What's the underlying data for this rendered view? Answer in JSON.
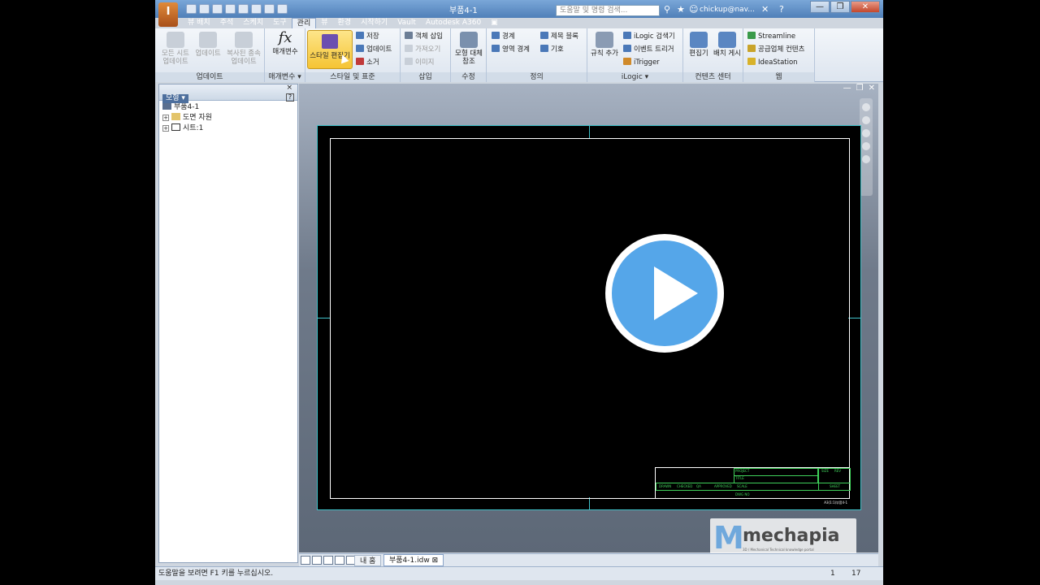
{
  "app": {
    "logo_letter": "I",
    "title": "부품4-1"
  },
  "search": {
    "placeholder": "도움말 및 명령 검색..."
  },
  "user": {
    "name": "chickup@nav..."
  },
  "window_buttons": {
    "minimize": "—",
    "restore": "❐",
    "close": "✕"
  },
  "tabs": [
    "뷰 배치",
    "주석",
    "스케치",
    "도구",
    "관리",
    "뷰",
    "환경",
    "시작하기",
    "Vault",
    "Autodesk A360"
  ],
  "active_tab": "관리",
  "ribbon": {
    "update": {
      "label": "업데이트",
      "buttons": [
        "모든 시트 업데이트",
        "업데이트",
        "복사된 종속 업데이트"
      ]
    },
    "parameters": {
      "label": "매개변수 ▾",
      "button": "매개변수",
      "fx": "fx"
    },
    "styles": {
      "label": "스타일 및 표준",
      "editor": "스타일 편집기",
      "save": "저장",
      "update": "업데이트",
      "purge": "소거"
    },
    "insert": {
      "label": "삽입",
      "insert_object": "객체 삽입",
      "import": "가져오기",
      "image": "이미지"
    },
    "modify": {
      "label": "수정",
      "button": "모형 대체 참조"
    },
    "define": {
      "label": "정의",
      "border": "경계",
      "zone_border": "영역 경계",
      "title_block": "제목 블록",
      "symbol": "기호"
    },
    "ilogic": {
      "label": "iLogic ▾",
      "add_rule": "규칙 추가",
      "browser": "iLogic 검색기",
      "event_trigger": "이벤트 트리거",
      "itrigger": "iTrigger"
    },
    "content_center": {
      "label": "컨텐츠 센터",
      "editor": "편집기",
      "publish": "배치 게시"
    },
    "web": {
      "label": "웹",
      "streamline": "Streamline",
      "supplier": "공급업체 컨텐츠",
      "ideastation": "IdeaStation"
    }
  },
  "browser": {
    "title": "모형 ▾",
    "help": "?",
    "close": "×",
    "tree": [
      {
        "label": "부품4-1",
        "expander": ""
      },
      {
        "label": "도면 자원",
        "expander": "+"
      },
      {
        "label": "시트:1",
        "expander": "+"
      }
    ]
  },
  "graphics": {
    "mdi": [
      "—",
      "❐",
      "✕"
    ],
    "titleblock": [
      "PROJECT",
      "TITLE",
      "DRAWN",
      "CHECKED",
      "QA",
      "APPROVED",
      "DWG NO",
      "SCALE",
      "SHEET",
      "REV",
      "SIZE"
    ],
    "sheet_code": "A3(1:1)부품4-1"
  },
  "watermark": {
    "mark": "M",
    "text": "mechapia",
    "sub": "3D / Mechanical Technical knowledge portal"
  },
  "doc_tabs": {
    "home": "내 홈",
    "doc": "부품4-1.idw",
    "doc_close": "⊠"
  },
  "status": {
    "text": "도움말을 보려면 F1 키를 누르십시오.",
    "num1": "1",
    "num2": "17"
  },
  "colors": {
    "accent": "#f5c433",
    "sheet_border": "#3fc1c9",
    "play": "#55a6e9",
    "titleblock": "#3fd05a"
  }
}
